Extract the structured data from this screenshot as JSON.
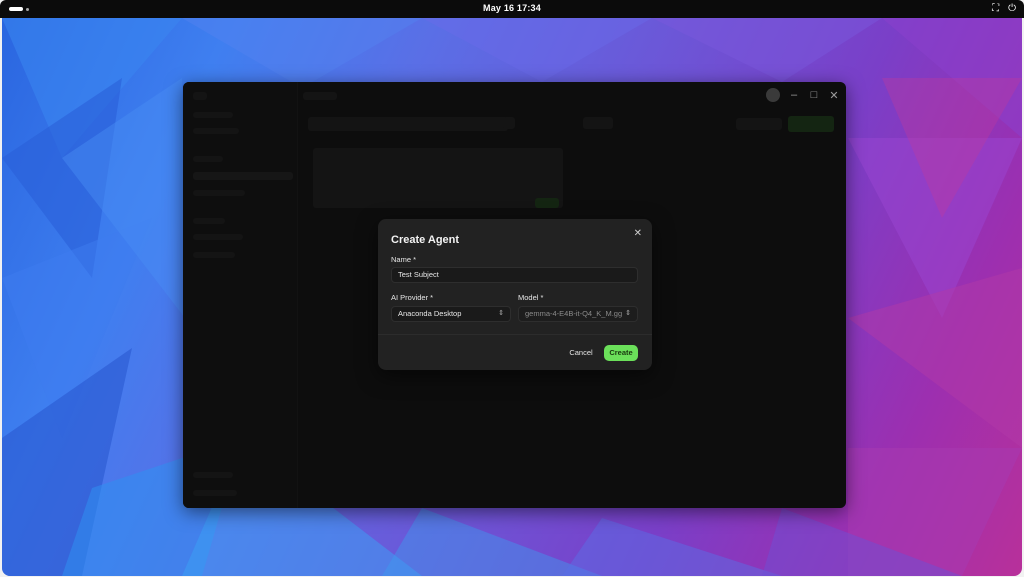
{
  "topbar": {
    "clock": "May 16  17:34",
    "tray_icons": [
      "network-icon",
      "power-icon"
    ]
  },
  "dialog": {
    "title": "Create Agent",
    "name_label": "Name *",
    "name_value": "Test Subject",
    "provider_label": "AI Provider *",
    "provider_value": "Anaconda Desktop",
    "model_label": "Model *",
    "model_value": "gemma-4-E4B-it-Q4_K_M.gg",
    "cancel_label": "Cancel",
    "create_label": "Create"
  },
  "colors": {
    "accent": "#6be05a",
    "dialog_bg": "#222222",
    "window_bg": "#141414"
  }
}
